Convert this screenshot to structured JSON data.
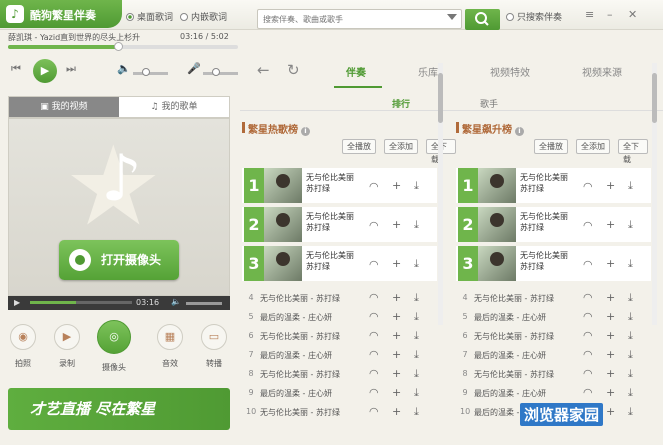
{
  "app": {
    "name": "酷狗繁星伴奏"
  },
  "header": {
    "mode_desktop": "桌面歌词",
    "mode_embed": "内嵌歌词",
    "search_placeholder": "搜索伴奏、歌曲或歌手",
    "accomp_only": "只搜索伴奏"
  },
  "player": {
    "song": "薛凯琪 - Yazid直到世界的尽头上杉升",
    "time": "03:16 / 5:02",
    "progress": 0.5
  },
  "nav": {
    "tabs": [
      "伴奏",
      "乐库",
      "视频特效",
      "视频来源"
    ],
    "active": "伴奏"
  },
  "left": {
    "tab_video": "我的视频",
    "tab_songs": "我的歌单",
    "camera_btn": "打开摄像头",
    "video_time": "03:16",
    "tools": [
      "拍照",
      "录制",
      "摄像头",
      "音效",
      "转播"
    ],
    "banner": "才艺直播 尽在繁星"
  },
  "subtabs": [
    "排行",
    "歌手"
  ],
  "lists": [
    {
      "title": "繁星热歌榜",
      "btns": [
        "全播放",
        "全添加",
        "全下载"
      ],
      "top": [
        {
          "rank": "1",
          "title": "无与伦比美丽",
          "artist": "苏打绿"
        },
        {
          "rank": "2",
          "title": "无与伦比美丽",
          "artist": "苏打绿"
        },
        {
          "rank": "3",
          "title": "无与伦比美丽",
          "artist": "苏打绿"
        }
      ],
      "rows": [
        {
          "rank": "4",
          "text": "无与伦比美丽 - 苏打绿"
        },
        {
          "rank": "5",
          "text": "最后的温柔 - 庄心妍"
        },
        {
          "rank": "6",
          "text": "无与伦比美丽 - 苏打绿"
        },
        {
          "rank": "7",
          "text": "最后的温柔 - 庄心妍"
        },
        {
          "rank": "8",
          "text": "无与伦比美丽 - 苏打绿"
        },
        {
          "rank": "9",
          "text": "最后的温柔 - 庄心妍"
        },
        {
          "rank": "10",
          "text": "无与伦比美丽 - 苏打绿"
        }
      ]
    },
    {
      "title": "繁星飙升榜",
      "btns": [
        "全播放",
        "全添加",
        "全下载"
      ],
      "top": [
        {
          "rank": "1",
          "title": "无与伦比美丽",
          "artist": "苏打绿"
        },
        {
          "rank": "2",
          "title": "无与伦比美丽",
          "artist": "苏打绿"
        },
        {
          "rank": "3",
          "title": "无与伦比美丽",
          "artist": "苏打绿"
        }
      ],
      "rows": [
        {
          "rank": "4",
          "text": "无与伦比美丽 - 苏打绿"
        },
        {
          "rank": "5",
          "text": "最后的温柔 - 庄心妍"
        },
        {
          "rank": "6",
          "text": "无与伦比美丽 - 苏打绿"
        },
        {
          "rank": "7",
          "text": "最后的温柔 - 庄心妍"
        },
        {
          "rank": "8",
          "text": "无与伦比美丽 - 苏打绿"
        },
        {
          "rank": "9",
          "text": "最后的温柔 - 庄心妍"
        },
        {
          "rank": "10",
          "text": "最后的温柔 - 庄心妍"
        }
      ]
    }
  ],
  "watermark": "浏览器家园",
  "colors": {
    "accent": "#4f9a33",
    "list_title": "#b06a3a"
  }
}
